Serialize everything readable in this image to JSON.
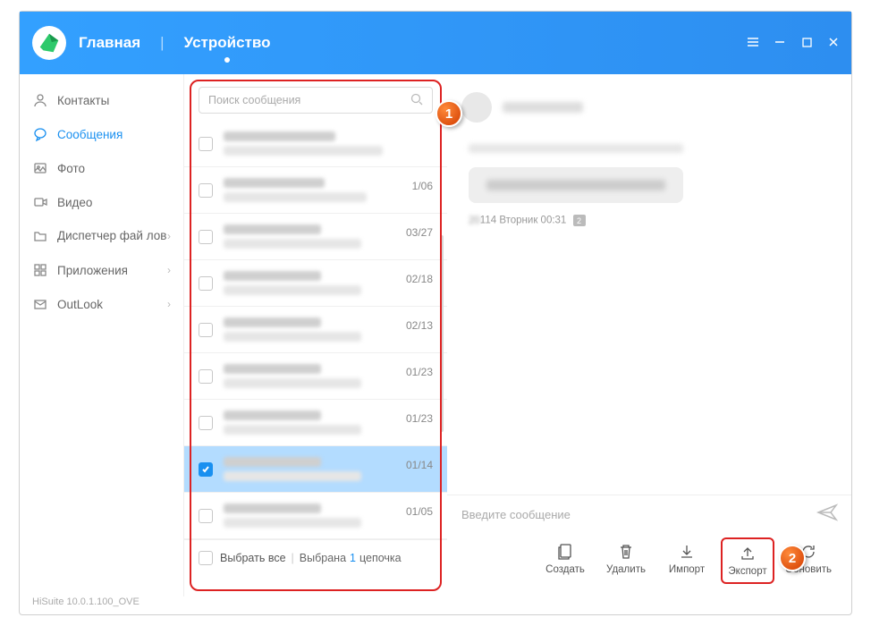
{
  "header": {
    "tab_main": "Главная",
    "tab_device": "Устройство"
  },
  "sidebar": {
    "items": [
      {
        "label": "Контакты",
        "key": "contacts"
      },
      {
        "label": "Сообщения",
        "key": "messages"
      },
      {
        "label": "Фото",
        "key": "photos"
      },
      {
        "label": "Видео",
        "key": "videos"
      },
      {
        "label": "Диспетчер фай лов",
        "key": "files"
      },
      {
        "label": "Приложения",
        "key": "apps"
      },
      {
        "label": "OutLook",
        "key": "outlook"
      }
    ]
  },
  "search": {
    "placeholder": "Поиск сообщения"
  },
  "messages": [
    {
      "date": ""
    },
    {
      "date": "1/06"
    },
    {
      "date": "03/27"
    },
    {
      "date": "02/18"
    },
    {
      "date": "02/13"
    },
    {
      "date": "01/23"
    },
    {
      "date": "01/23"
    },
    {
      "date": "01/14",
      "selected": true
    },
    {
      "date": "01/05"
    }
  ],
  "selectall": {
    "label": "Выбрать все",
    "state": "Выбрана",
    "count": "1",
    "unit": "цепочка"
  },
  "conversation": {
    "meta_prefix": "114 Вторник 00:31",
    "badge": "2"
  },
  "compose": {
    "placeholder": "Введите сообщение"
  },
  "toolbar": {
    "create": "Создать",
    "delete": "Удалить",
    "import": "Импорт",
    "export": "Экспорт",
    "refresh": "Обновить"
  },
  "footer": {
    "version": "HiSuite 10.0.1.100_OVE"
  },
  "callouts": {
    "one": "1",
    "two": "2"
  }
}
